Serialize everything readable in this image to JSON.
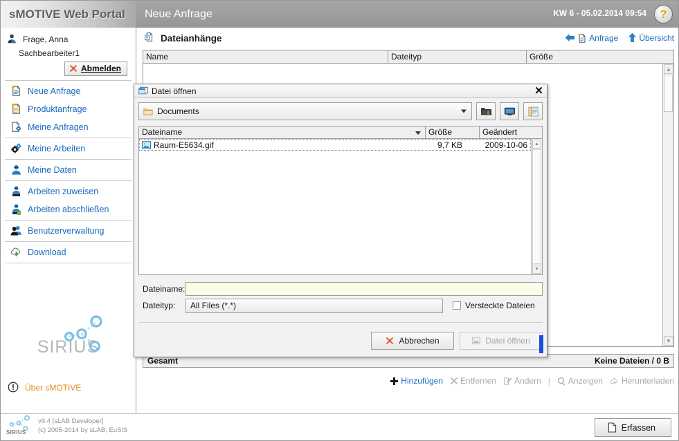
{
  "header": {
    "brand": "sMOTIVE Web Portal",
    "page_title": "Neue Anfrage",
    "clock": "KW 6 - 05.02.2014 09:54",
    "help_label": "?"
  },
  "sidebar": {
    "user_name": "Frage, Anna",
    "user_role": "Sachbearbeiter1",
    "logout_label": "Abmelden",
    "groups": [
      {
        "items": [
          {
            "label": "Neue Anfrage",
            "icon": "new-request-icon"
          },
          {
            "label": "Produktanfrage",
            "icon": "product-request-icon"
          },
          {
            "label": "Meine Anfragen",
            "icon": "my-requests-icon"
          }
        ]
      },
      {
        "items": [
          {
            "label": "Meine Arbeiten",
            "icon": "gear-icon"
          }
        ]
      },
      {
        "items": [
          {
            "label": "Meine Daten",
            "icon": "user-icon"
          }
        ]
      },
      {
        "items": [
          {
            "label": "Arbeiten zuweisen",
            "icon": "assign-work-icon"
          },
          {
            "label": "Arbeiten abschließen",
            "icon": "complete-work-icon"
          }
        ]
      },
      {
        "items": [
          {
            "label": "Benutzerverwaltung",
            "icon": "users-icon"
          }
        ]
      },
      {
        "items": [
          {
            "label": "Download",
            "icon": "download-cloud-icon"
          }
        ]
      }
    ],
    "logo_word": "SIRIUS",
    "about_label": "Über sMOTIVE"
  },
  "main": {
    "panel_title": "Dateianhänge",
    "head_links": [
      {
        "label": "Anfrage",
        "icon": "back-arrow-icon"
      },
      {
        "label": "Übersicht",
        "icon": "up-arrow-icon"
      }
    ],
    "grid": {
      "columns": [
        "Name",
        "Dateityp",
        "Größe"
      ],
      "rows": []
    },
    "total_label": "Gesamt",
    "total_value": "Keine Dateien / 0 B",
    "actions": [
      {
        "label": "Hinzufügen",
        "icon": "plus-icon",
        "enabled": true
      },
      {
        "label": "Entfernen",
        "icon": "remove-x-icon",
        "enabled": false
      },
      {
        "label": "Ändern",
        "icon": "edit-pencil-icon",
        "enabled": false
      },
      {
        "label": "Anzeigen",
        "icon": "magnifier-icon",
        "enabled": false
      },
      {
        "label": "Herunterladen",
        "icon": "download-cloud-icon",
        "enabled": false
      }
    ]
  },
  "footer": {
    "logo_word": "SIRIUS",
    "version": "v9.4 [sLAB Developer]",
    "copyright": "(c) 2005-2014 by sLAB, EuSIS",
    "submit_label": "Erfassen"
  },
  "dialog": {
    "title": "Datei öffnen",
    "close_label": "✕",
    "path_value": "Documents",
    "toolbar_buttons": [
      {
        "icon": "new-folder-icon",
        "name": "create-folder-button"
      },
      {
        "icon": "desktop-icon",
        "name": "desktop-button"
      },
      {
        "icon": "list-view-icon",
        "name": "list-view-button"
      }
    ],
    "list_columns": [
      "Dateiname",
      "Größe",
      "Geändert"
    ],
    "files": [
      {
        "name": "Raum-E5634.gif",
        "size": "9,7 KB",
        "modified": "2009-10-06",
        "icon": "image-file-icon"
      }
    ],
    "filename_label": "Dateiname:",
    "filename_value": "",
    "filetype_label": "Dateityp:",
    "filetype_value": "All Files (*.*)",
    "hidden_files_label": "Versteckte Dateien",
    "hidden_files_checked": false,
    "cancel_label": "Abbrechen",
    "open_label": "Datei öffnen",
    "open_enabled": false
  },
  "colors": {
    "link_blue": "#1b6bbf",
    "accent_orange": "#e08a1e",
    "header_gray": "#9d9d9d",
    "field_yellow": "#fcfce8",
    "resize_blue": "#1b4ed8"
  }
}
